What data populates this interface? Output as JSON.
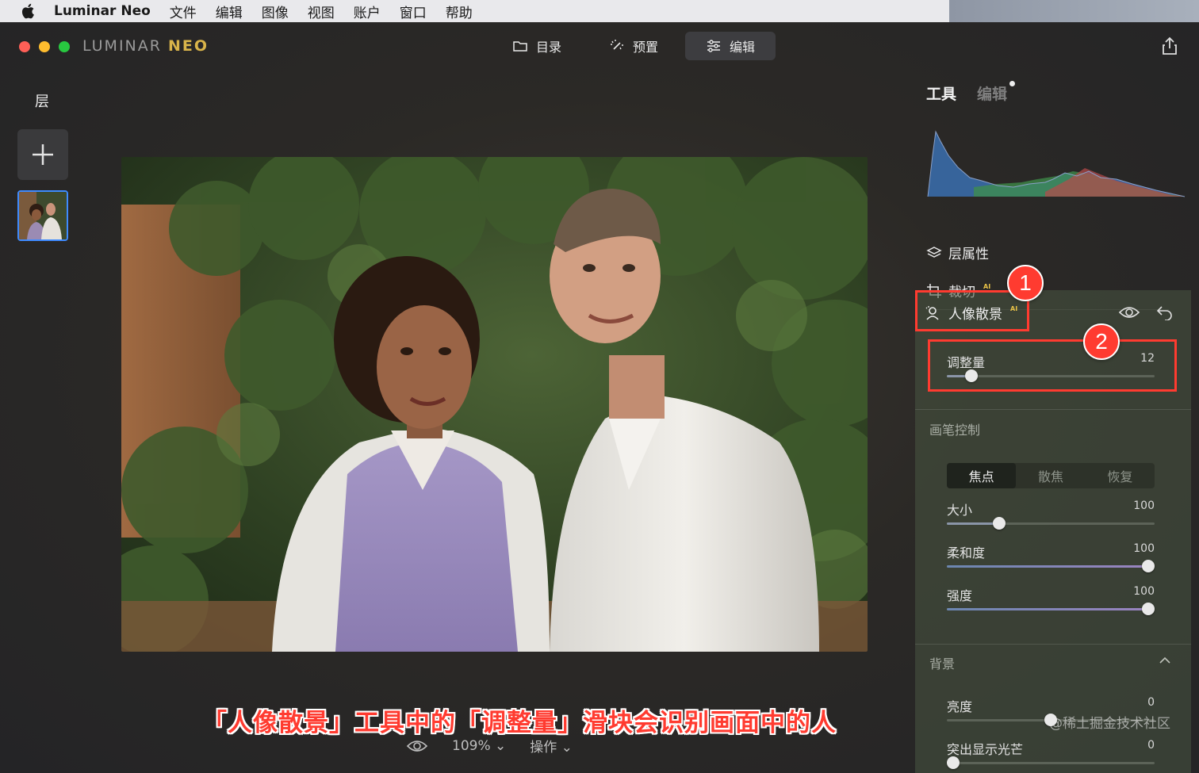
{
  "menubar": {
    "app_name": "Luminar Neo",
    "items": [
      "文件",
      "编辑",
      "图像",
      "视图",
      "账户",
      "窗口",
      "帮助"
    ]
  },
  "window": {
    "brand_main": "LUMINAR",
    "brand_accent": "NEO",
    "nav": [
      {
        "label": "目录",
        "icon": "folder-icon"
      },
      {
        "label": "预置",
        "icon": "magic-wand-icon"
      },
      {
        "label": "编辑",
        "icon": "sliders-icon",
        "active": true
      }
    ]
  },
  "layers": {
    "title": "层"
  },
  "canvas": {
    "zoom": "109%",
    "actions": "操作",
    "caption": "「人像散景」工具中的「调整量」滑块会识别画面中的人"
  },
  "right_panel": {
    "tab_tools": "工具",
    "tab_edits": "编辑",
    "layer_properties": "层属性",
    "crop": "裁切",
    "crop_ai": "AI",
    "tool_name": "人像散景",
    "tool_ai": "AI",
    "annotation_1": "1",
    "annotation_2": "2",
    "amount": {
      "label": "调整量",
      "value": "12",
      "level": 0.12
    },
    "brush_section": "画笔控制",
    "brush_modes": [
      "焦点",
      "散焦",
      "恢复"
    ],
    "brush_mode_selected": "焦点",
    "size": {
      "label": "大小",
      "value": "100",
      "level": 0.25
    },
    "softness": {
      "label": "柔和度",
      "value": "100",
      "level": 0.97
    },
    "strength": {
      "label": "强度",
      "value": "100",
      "level": 0.97
    },
    "background_section": "背景",
    "brightness": {
      "label": "亮度",
      "value": "0",
      "level": 0.5
    },
    "highlights": {
      "label": "突出显示光芒",
      "value": "0",
      "level": 0.03
    }
  },
  "watermark": "@稀土掘金技术社区",
  "colors": {
    "accent_red": "#ff3b30",
    "selection_blue": "#3e8bff",
    "ai_badge": "#e8c247"
  }
}
